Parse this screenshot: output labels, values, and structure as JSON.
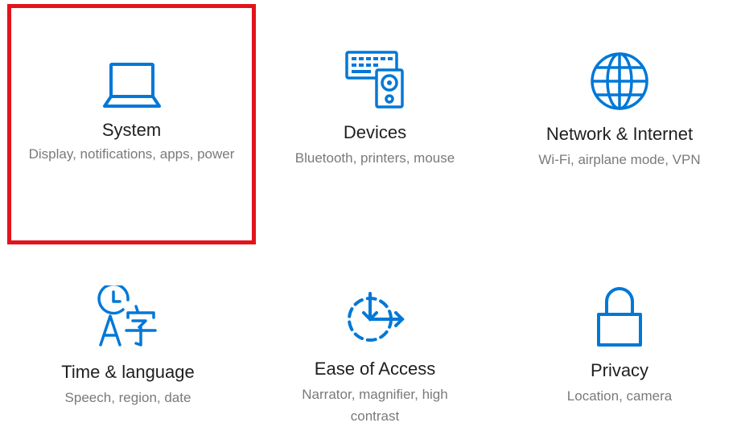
{
  "theme": {
    "icon_color": "#0078d7",
    "selection_border_color": "#e3131b"
  },
  "tiles": [
    {
      "title": "System",
      "description": "Display, notifications, apps, power",
      "icon": "laptop-icon",
      "selected": true
    },
    {
      "title": "Devices",
      "description": "Bluetooth, printers, mouse",
      "icon": "devices-icon",
      "selected": false
    },
    {
      "title": "Network & Internet",
      "description": "Wi-Fi, airplane mode, VPN",
      "icon": "globe-icon",
      "selected": false
    },
    {
      "title": "Time & language",
      "description": "Speech, region, date",
      "icon": "time-language-icon",
      "selected": false
    },
    {
      "title": "Ease of Access",
      "description": "Narrator, magnifier, high contrast",
      "icon": "ease-of-access-icon",
      "selected": false
    },
    {
      "title": "Privacy",
      "description": "Location, camera",
      "icon": "lock-icon",
      "selected": false
    }
  ]
}
